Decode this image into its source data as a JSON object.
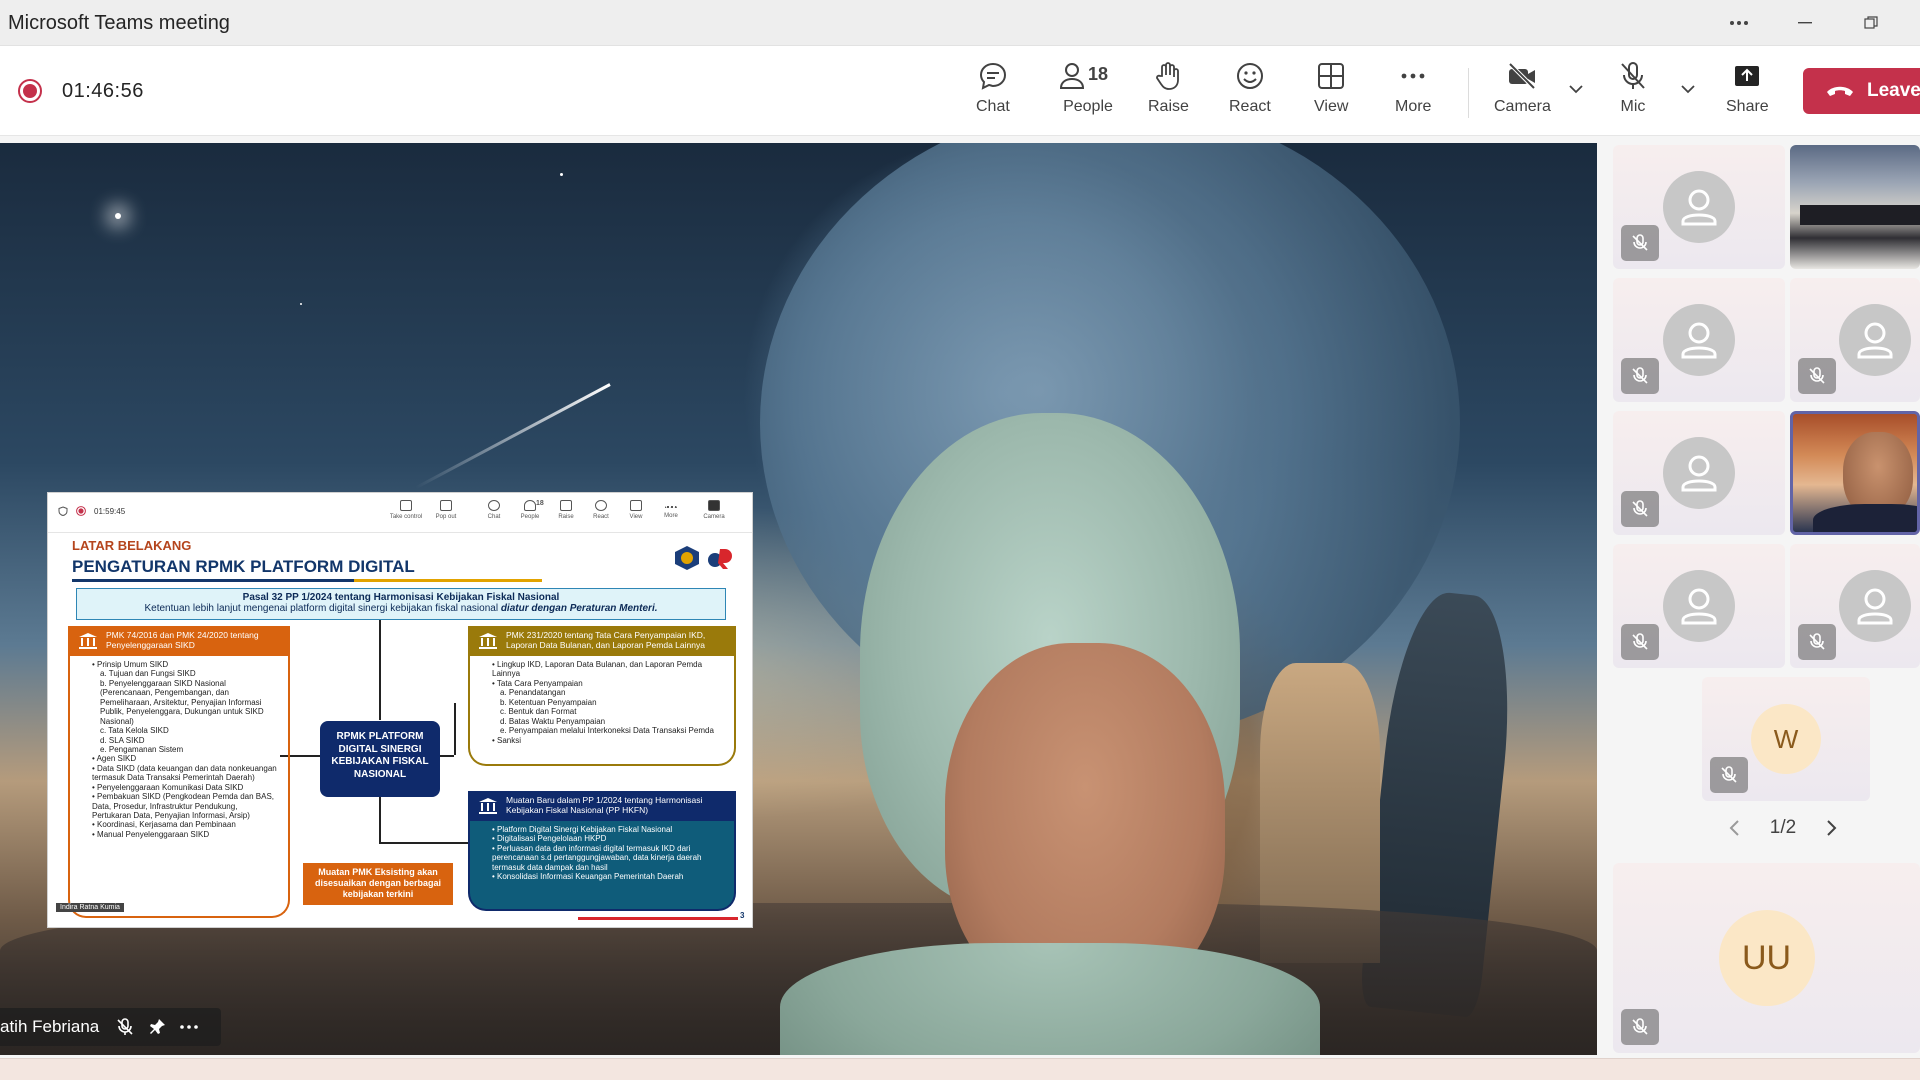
{
  "window": {
    "title": "Microsoft Teams meeting"
  },
  "toolbar": {
    "timer": "01:46:56",
    "buttons": {
      "chat": "Chat",
      "people": "People",
      "people_count": "18",
      "raise": "Raise",
      "react": "React",
      "view": "View",
      "more": "More",
      "camera": "Camera",
      "mic": "Mic",
      "share": "Share",
      "leave": "Leave"
    },
    "colors": {
      "recording": "#c4314b",
      "leave": "#c4314b"
    }
  },
  "main_video": {
    "participant_name": "atih Febriana"
  },
  "shared_slide": {
    "mini_toolbar": {
      "timer": "01:59:45",
      "take_control": "Take control",
      "pop_out": "Pop out",
      "chat": "Chat",
      "people": "People",
      "people_count": "18",
      "raise": "Raise",
      "react": "React",
      "view": "View",
      "more": "More",
      "camera": "Camera"
    },
    "section": "LATAR BELAKANG",
    "heading": "PENGATURAN RPMK PLATFORM DIGITAL",
    "banner_title": "Pasal 32 PP 1/2024 tentang Harmonisasi Kebijakan Fiskal Nasional",
    "banner_text_start": "Ketentuan lebih lanjut mengenai platform digital sinergi kebijakan fiskal nasional ",
    "banner_text_emph": "diatur dengan Peraturan Menteri.",
    "left_box": {
      "header": "PMK 74/2016 dan PMK 24/2020 tentang Penyelenggaraan SIKD",
      "items": [
        "•  Prinsip Umum SIKD",
        "a.  Tujuan dan Fungsi SIKD",
        "b.  Penyelenggaraan SIKD Nasional (Perencanaan, Pengembangan, dan Pemeliharaan, Arsitektur, Penyajian Informasi Publik, Penyelenggara, Dukungan untuk SIKD Nasional)",
        "c.  Tata Kelola SIKD",
        "d.  SLA SIKD",
        "e.  Pengamanan Sistem",
        "•  Agen SIKD",
        "•  Data SIKD (data keuangan dan data nonkeuangan termasuk Data Transaksi Pemerintah Daerah)",
        "•  Penyelenggaraan Komunikasi Data SIKD",
        "•  Pembakuan SIKD (Pengkodean Pemda dan BAS, Data, Prosedur, Infrastruktur Pendukung, Pertukaran Data, Penyajian Informasi, Arsip)",
        "•  Koordinasi, Kerjasama dan Pembinaan",
        "•  Manual Penyelenggaraan SIKD"
      ]
    },
    "center_box": "RPMK PLATFORM DIGITAL SINERGI KEBIJAKAN FISKAL NASIONAL",
    "orange_box": "Muatan PMK Eksisting akan disesuaikan dengan berbagai kebijakan terkini",
    "right_top_box": {
      "header": "PMK 231/2020 tentang Tata Cara Penyampaian IKD, Laporan Data Bulanan, dan Laporan Pemda Lainnya",
      "items": [
        "•  Lingkup IKD, Laporan Data Bulanan, dan Laporan Pemda Lainnya",
        "•  Tata Cara Penyampaian",
        "a.  Penandatangan",
        "b.  Ketentuan Penyampaian",
        "c.  Bentuk dan Format",
        "d.  Batas Waktu Penyampaian",
        "e.  Penyampaian melalui Interkoneksi Data Transaksi Pemda",
        "•  Sanksi"
      ]
    },
    "right_bottom_box": {
      "header": "Muatan Baru dalam PP 1/2024 tentang Harmonisasi Kebijakan Fiskal Nasional (PP HKFN)",
      "items": [
        "•  Platform Digital Sinergi Kebijakan Fiskal Nasional",
        "•  Digitalisasi Pengelolaan HKPD",
        "•  Perluasan data dan informasi digital termasuk IKD dari perencanaan s.d pertanggungjawaban, data kinerja daerah termasuk data dampak dan hasil",
        "•  Konsolidasi Informasi Keuangan Pemerintah Daerah"
      ]
    },
    "presenter_tag": "Indira Ratna Kumia",
    "page_number": "3"
  },
  "participants": {
    "initials_w": "W",
    "initials_uu": "UU",
    "pager": "1/2"
  }
}
